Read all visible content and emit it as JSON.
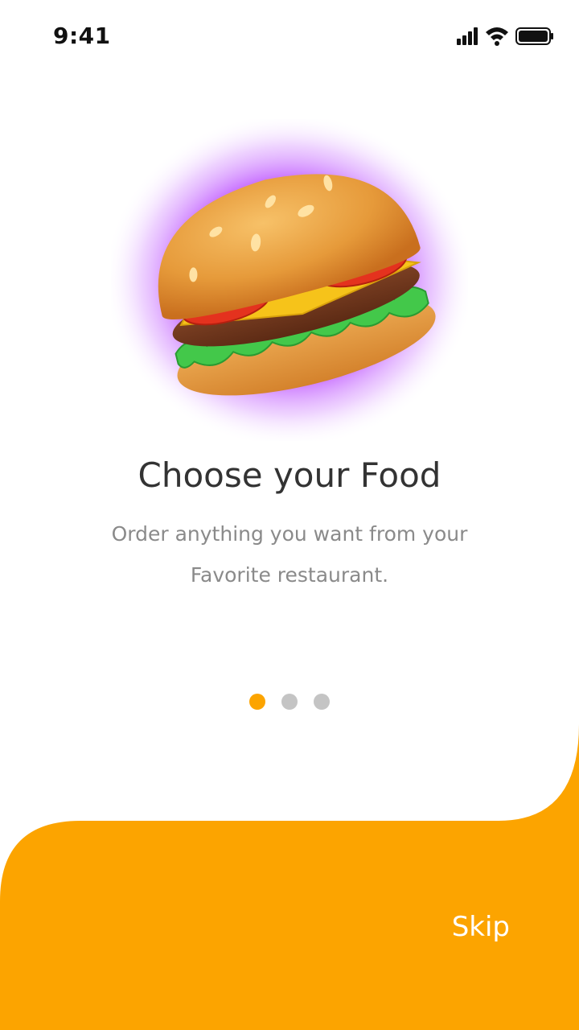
{
  "status_bar": {
    "time": "9:41",
    "icons": [
      "cellular-signal-icon",
      "wifi-icon",
      "battery-icon"
    ]
  },
  "onboarding": {
    "image": "burger-illustration",
    "title": "Choose your Food",
    "subtitle_line1": "Order anything you want from your",
    "subtitle_line2": "Favorite restaurant.",
    "page_indicator": {
      "total": 3,
      "current": 1
    }
  },
  "footer": {
    "skip_label": "Skip"
  },
  "colors": {
    "accent": "#FCA400",
    "inactive_dot": "#C4C4C4",
    "title": "#333333",
    "subtitle": "#8A8A8A",
    "glow": "#B43CFF"
  }
}
